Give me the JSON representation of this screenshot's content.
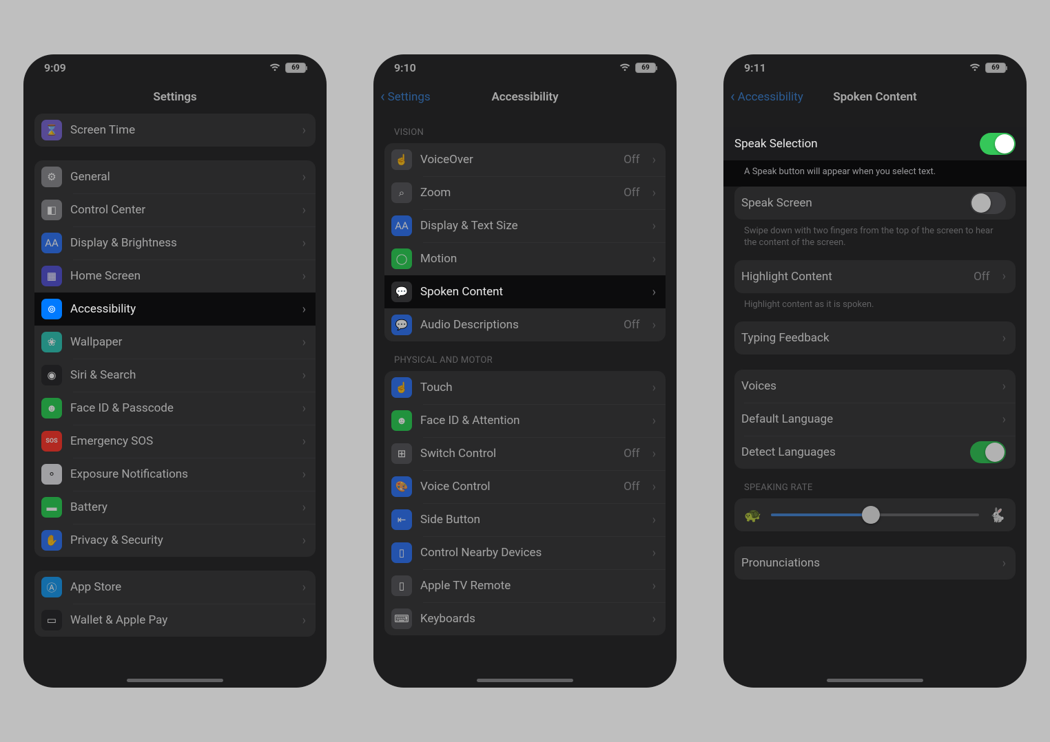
{
  "phone1": {
    "time": "9:09",
    "battery": "69",
    "title": "Settings",
    "rows_top": [
      {
        "label": "Screen Time",
        "icon_bg": "#7d6bd6",
        "glyph": "⌛"
      }
    ],
    "rows_main": [
      {
        "label": "General",
        "icon_bg": "#8e8e93",
        "glyph": "⚙"
      },
      {
        "label": "Control Center",
        "icon_bg": "#8e8e93",
        "glyph": "◧"
      },
      {
        "label": "Display & Brightness",
        "icon_bg": "#3478f6",
        "glyph": "AA"
      },
      {
        "label": "Home Screen",
        "icon_bg": "#5856d6",
        "glyph": "▦"
      },
      {
        "label": "Accessibility",
        "icon_bg": "#007aff",
        "glyph": "⊚",
        "highlight": true
      },
      {
        "label": "Wallpaper",
        "icon_bg": "#34c7b8",
        "glyph": "❀"
      },
      {
        "label": "Siri & Search",
        "icon_bg": "#2c2c2e",
        "glyph": "◉"
      },
      {
        "label": "Face ID & Passcode",
        "icon_bg": "#30d158",
        "glyph": "☻"
      },
      {
        "label": "Emergency SOS",
        "icon_bg": "#ff3b30",
        "glyph": "SOS",
        "small": true
      },
      {
        "label": "Exposure Notifications",
        "icon_bg": "#e5e5ea",
        "glyph": "⚬",
        "dark_glyph": true
      },
      {
        "label": "Battery",
        "icon_bg": "#30d158",
        "glyph": "▬"
      },
      {
        "label": "Privacy & Security",
        "icon_bg": "#3478f6",
        "glyph": "✋"
      }
    ],
    "rows_bottom": [
      {
        "label": "App Store",
        "icon_bg": "#1e9cf1",
        "glyph": "Ⓐ"
      },
      {
        "label": "Wallet & Apple Pay",
        "icon_bg": "#2c2c2e",
        "glyph": "▭"
      }
    ]
  },
  "phone2": {
    "time": "9:10",
    "battery": "69",
    "back": "Settings",
    "title": "Accessibility",
    "vision_header": "VISION",
    "vision": [
      {
        "label": "VoiceOver",
        "detail": "Off",
        "icon_bg": "#5a5a5d",
        "glyph": "☝"
      },
      {
        "label": "Zoom",
        "detail": "Off",
        "icon_bg": "#5a5a5d",
        "glyph": "⌕"
      },
      {
        "label": "Display & Text Size",
        "icon_bg": "#3478f6",
        "glyph": "AA"
      },
      {
        "label": "Motion",
        "icon_bg": "#30d158",
        "glyph": "◯"
      },
      {
        "label": "Spoken Content",
        "icon_bg": "#2c2c2e",
        "glyph": "💬",
        "highlight": true
      },
      {
        "label": "Audio Descriptions",
        "detail": "Off",
        "icon_bg": "#3478f6",
        "glyph": "💬"
      }
    ],
    "motor_header": "PHYSICAL AND MOTOR",
    "motor": [
      {
        "label": "Touch",
        "icon_bg": "#3478f6",
        "glyph": "☝"
      },
      {
        "label": "Face ID & Attention",
        "icon_bg": "#30d158",
        "glyph": "☻"
      },
      {
        "label": "Switch Control",
        "detail": "Off",
        "icon_bg": "#5a5a5d",
        "glyph": "⊞"
      },
      {
        "label": "Voice Control",
        "detail": "Off",
        "icon_bg": "#3478f6",
        "glyph": "🎨"
      },
      {
        "label": "Side Button",
        "icon_bg": "#3478f6",
        "glyph": "⇤"
      },
      {
        "label": "Control Nearby Devices",
        "icon_bg": "#3478f6",
        "glyph": "▯"
      },
      {
        "label": "Apple TV Remote",
        "icon_bg": "#5a5a5d",
        "glyph": "▯"
      },
      {
        "label": "Keyboards",
        "icon_bg": "#5a5a5d",
        "glyph": "⌨"
      }
    ]
  },
  "phone3": {
    "time": "9:11",
    "battery": "69",
    "back": "Accessibility",
    "title": "Spoken Content",
    "speak_selection_label": "Speak Selection",
    "speak_selection_on": true,
    "speak_selection_footer": "A Speak button will appear when you select text.",
    "speak_screen_label": "Speak Screen",
    "speak_screen_on": false,
    "speak_screen_footer": "Swipe down with two fingers from the top of the screen to hear the content of the screen.",
    "highlight_content_label": "Highlight Content",
    "highlight_content_detail": "Off",
    "highlight_content_footer": "Highlight content as it is spoken.",
    "typing_feedback_label": "Typing Feedback",
    "voices_label": "Voices",
    "default_language_label": "Default Language",
    "detect_languages_label": "Detect Languages",
    "detect_languages_on": true,
    "speaking_rate_header": "SPEAKING RATE",
    "speaking_rate_pct": 48,
    "pronunciations_label": "Pronunciations"
  }
}
